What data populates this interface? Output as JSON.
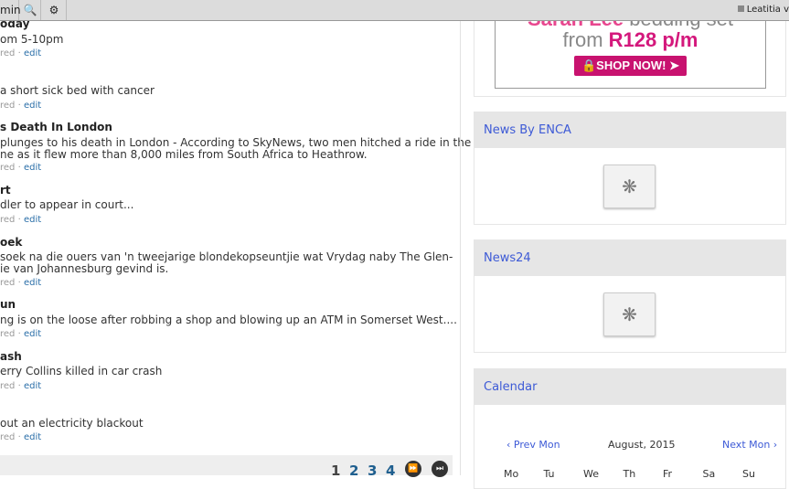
{
  "toolbar": {
    "admin_label": "min",
    "user_label": "Leatitia v"
  },
  "articles": [
    {
      "title": "oday",
      "desc": "om 5-10pm",
      "meta": "red",
      "edit": "edit"
    },
    {
      "title": "",
      "desc": "a short sick bed with cancer",
      "meta": "red",
      "edit": "edit"
    },
    {
      "title": "s Death In London",
      "desc": "plunges to his death in London - According to SkyNews, two men hitched a ride in the\nne as it flew more than 8,000 miles from South Africa to Heathrow.",
      "meta": "red",
      "edit": "edit"
    },
    {
      "title": "rt",
      "desc": "dler to appear in court...",
      "meta": "red",
      "edit": "edit"
    },
    {
      "title": "oek",
      "desc": "soek na die ouers van 'n tweejarige blondekopseuntjie wat Vrydag naby The Glen-\nie van Johannesburg gevind is.",
      "meta": "red",
      "edit": "edit"
    },
    {
      "title": "un",
      "desc": "ng is on the loose after robbing a shop and blowing up an ATM in Somerset West....",
      "meta": "red",
      "edit": "edit"
    },
    {
      "title": "ash",
      "desc": "erry Collins killed in car crash",
      "meta": "red",
      "edit": "edit"
    },
    {
      "title": "",
      "desc": "out an electricity blackout",
      "meta": "red",
      "edit": "edit"
    }
  ],
  "pager": {
    "pages": [
      "1",
      "2",
      "3",
      "4"
    ]
  },
  "ad": {
    "brand": "Sarah Lee",
    "product": "bedding set",
    "from": "from",
    "price": "R128 p/m",
    "cta": "SHOP NOW!"
  },
  "widgets": {
    "enca": "News By ENCA",
    "news24": "News24",
    "calendar": "Calendar"
  },
  "calendar": {
    "prev": "‹ Prev Mon",
    "month": "August, 2015",
    "next": "Next Mon ›",
    "days": [
      "Mo",
      "Tu",
      "We",
      "Th",
      "Fr",
      "Sa",
      "Su"
    ]
  }
}
